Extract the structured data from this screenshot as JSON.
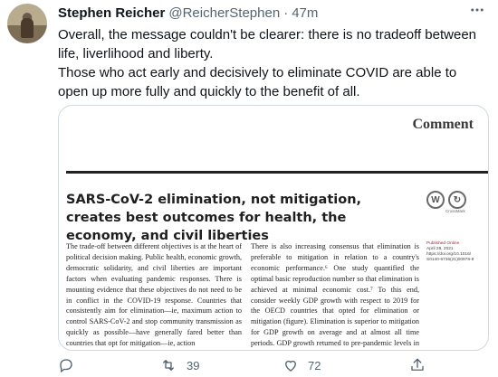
{
  "author": {
    "name": "Stephen Reicher",
    "handle": "@ReicherStephen",
    "separator": "·",
    "time": "47m"
  },
  "tweet": {
    "paragraph1": "Overall, the message couldn't be clearer: there is no tradeoff between life, liverlihood and liberty.",
    "paragraph2": "Those who act early and decisively to eliminate COVID are able to open up more fully and quickly to the benefit of all."
  },
  "card": {
    "section_label": "Comment",
    "title": "SARS-CoV-2 elimination, not mitigation, creates best outcomes for health, the economy, and civil liberties",
    "badge_w": "W",
    "badge_cross": "↻",
    "crossmark_label": "CrossMark",
    "meta": {
      "published": "Published Online",
      "date": "April 28, 2021",
      "doi_url": "https://doi.org/10.1016/",
      "doi_id": "S0140-6736(21)00978-8"
    },
    "column1": "The trade-off between different objectives is at the heart of political decision making. Public health, economic growth, democratic solidarity, and civil liberties are important factors when evaluating pandemic responses. There is mounting evidence that these objectives do not need to be in conflict in the COVID-19 response. Countries that consistently aim for elimination—ie, maximum action to control SARS-CoV-2 and stop community transmission as quickly as possible—have generally fared better than countries that opt for mitigation—ie, action",
    "column2": "There is also increasing consensus that elimination is preferable to mitigation in relation to a country's economic performance.⁶ One study quantified the optimal basic reproduction number so that elimination is achieved at minimal economic cost.⁷ To this end, consider weekly GDP growth with respect to 2019 for the OECD countries that opted for elimination or mitigation (figure). Elimination is superior to mitigation for GDP growth on average and at almost all time periods. GDP growth returned to pre-pandemic levels in early 2021 in the"
  },
  "actions": {
    "retweets": "39",
    "likes": "72"
  },
  "icons": {
    "reply": "reply-icon",
    "retweet": "retweet-icon",
    "like": "heart-icon",
    "share": "share-icon",
    "more": "more-icon"
  }
}
